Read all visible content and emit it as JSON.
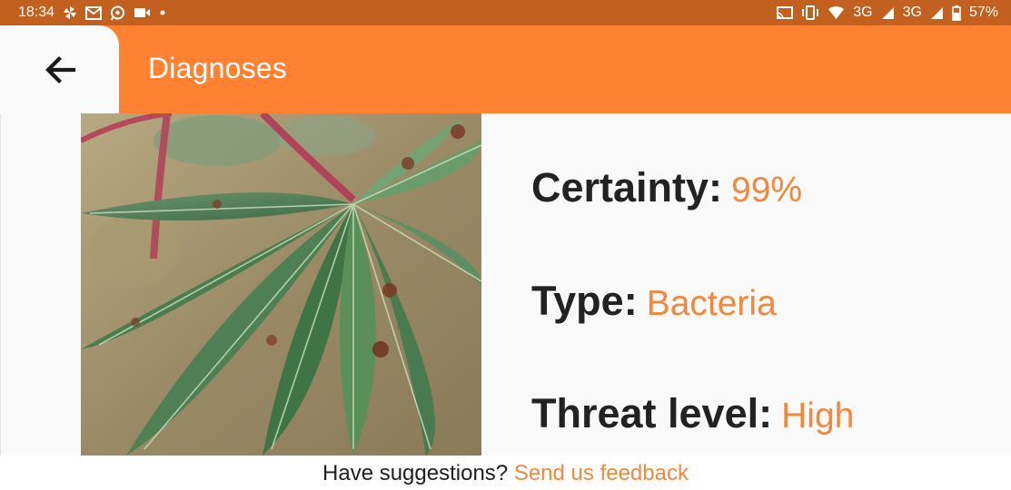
{
  "status_bar": {
    "time": "18:34",
    "network_1": "3G",
    "network_2": "3G",
    "battery": "57%",
    "icons": [
      "pinwheel-icon",
      "gmail-icon",
      "whatsapp-icon",
      "video-call-icon",
      "dot-icon",
      "cast-icon",
      "vibrate-icon",
      "wifi-icon",
      "signal-icon",
      "battery-icon"
    ]
  },
  "app_bar": {
    "title": "Diagnoses",
    "back_icon": "arrow-left-icon"
  },
  "diagnosis": {
    "certainty_label": "Certainty:",
    "certainty_value": "99%",
    "type_label": "Type:",
    "type_value": "Bacteria",
    "threat_label": "Threat level:",
    "threat_value": "High"
  },
  "footer": {
    "question": "Have suggestions?",
    "link": "Send us feedback"
  },
  "colors": {
    "status_bar": "#c2611f",
    "app_bar": "#fe8232",
    "accent_text": "#f4873c",
    "label_text": "#222222",
    "content_bg": "#f9f9f9"
  }
}
